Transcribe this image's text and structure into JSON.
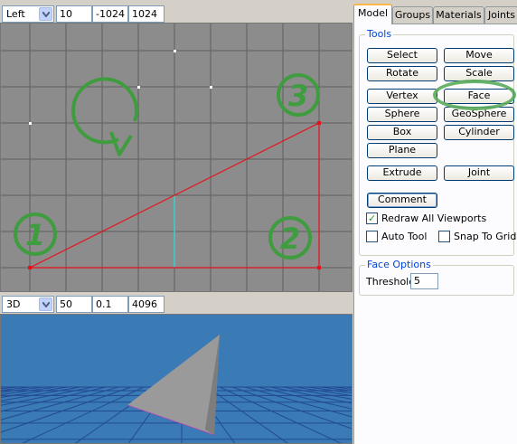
{
  "top_viewport_toolbar": {
    "view": "Left",
    "grid": "10",
    "min": "-1024",
    "max": "1024"
  },
  "bottom_viewport_toolbar": {
    "view": "3D",
    "fov": "50",
    "near": "0.1",
    "far": "4096"
  },
  "annotations": {
    "one": "1",
    "two": "2",
    "three": "3"
  },
  "tabs": [
    "Model",
    "Groups",
    "Materials",
    "Joints"
  ],
  "tools": {
    "title": "Tools",
    "select": "Select",
    "move": "Move",
    "rotate": "Rotate",
    "scale": "Scale",
    "vertex": "Vertex",
    "face": "Face",
    "sphere": "Sphere",
    "geosphere": "GeoSphere",
    "box": "Box",
    "cylinder": "Cylinder",
    "plane": "Plane",
    "extrude": "Extrude",
    "joint": "Joint",
    "comment": "Comment",
    "redraw_all": "Redraw All Viewports",
    "auto_tool": "Auto Tool",
    "snap_to_grid": "Snap To Grid",
    "redraw_checked": true,
    "auto_checked": false,
    "snap_checked": false
  },
  "face_options": {
    "title": "Face Options",
    "threshold_label": "Threshold",
    "threshold_value": "5"
  },
  "colors": {
    "grid_background": "#8c8c8c",
    "grid_lines": "#5e5e5e",
    "triangle_edge": "#e8101a",
    "annotation_green": "#3f9c3f",
    "viewport3d_background": "#3a7ab5"
  }
}
